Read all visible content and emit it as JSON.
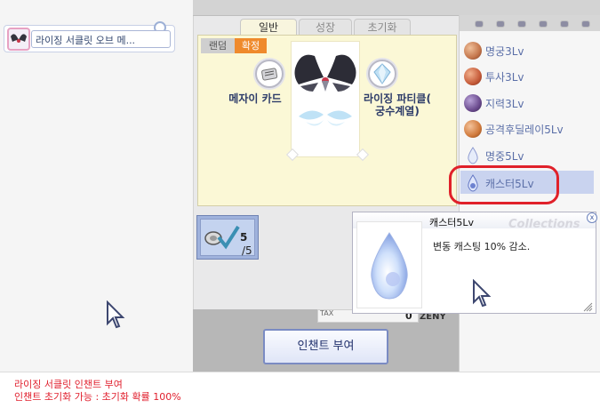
{
  "left_panel": {
    "item_name": "라이징 서클릿 오브 메..."
  },
  "tabs": [
    {
      "label": "일반",
      "active": true
    },
    {
      "label": "성장",
      "active": false
    },
    {
      "label": "초기화",
      "active": false
    }
  ],
  "mode": {
    "random_label": "랜덤",
    "confirm_label": "확정"
  },
  "slots": {
    "left_label": "메자이 카드",
    "right_label_line1": "라이징 파티클(",
    "right_label_line2": "궁수계열)"
  },
  "count": {
    "current": "5",
    "total": "/5"
  },
  "zeny": {
    "tax_label": "TAX",
    "value": "0",
    "unit": "ZENY"
  },
  "enchant_button": "인챈트 부여",
  "options": [
    {
      "label": "명궁3Lv",
      "color": "#c4764c"
    },
    {
      "label": "투사3Lv",
      "color": "#c65c3a"
    },
    {
      "label": "지력3Lv",
      "color": "#6b4b8e"
    },
    {
      "label": "공격후딜레이5Lv",
      "color": "#d07a3c"
    },
    {
      "label": "명중5Lv",
      "color": "#b8c4ea"
    },
    {
      "label": "캐스터5Lv",
      "color": "#7c8fd4",
      "selected": true
    }
  ],
  "tooltip": {
    "title": "캐스터5Lv",
    "watermark": "Collections",
    "close": "x",
    "description": "변동 캐스팅 10% 감소."
  },
  "status": {
    "line1": "라이징 서클릿 인챈트 부여",
    "line2": "인챈트 초기화 가능 : 초기화 확률 100%"
  },
  "colors": {
    "highlight": "#e0212a",
    "confirm_accent": "#ef8a2c",
    "status_text": "#e01e2c"
  }
}
